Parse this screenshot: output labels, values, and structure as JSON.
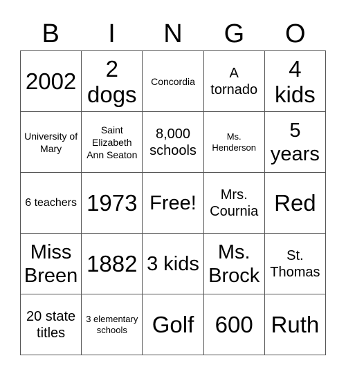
{
  "header": {
    "letters": [
      "B",
      "I",
      "N",
      "G",
      "O"
    ]
  },
  "cells": [
    {
      "text": "2002",
      "size": "s-xl"
    },
    {
      "text": "2 dogs",
      "size": "s-xl"
    },
    {
      "text": "Concordia",
      "size": "s-s"
    },
    {
      "text": "A tornado",
      "size": "s-m"
    },
    {
      "text": "4 kids",
      "size": "s-xl"
    },
    {
      "text": "University of Mary",
      "size": "s-s"
    },
    {
      "text": "Saint Elizabeth Ann Seaton",
      "size": "s-s"
    },
    {
      "text": "8,000 schools",
      "size": "s-m"
    },
    {
      "text": "Ms. Henderson",
      "size": "s-xs"
    },
    {
      "text": "5 years",
      "size": "s-l"
    },
    {
      "text": "6 teachers",
      "size": "s-sm"
    },
    {
      "text": "1973",
      "size": "s-xl"
    },
    {
      "text": "Free!",
      "size": "s-l"
    },
    {
      "text": "Mrs. Cournia",
      "size": "s-m"
    },
    {
      "text": "Red",
      "size": "s-xl"
    },
    {
      "text": "Miss Breen",
      "size": "s-l"
    },
    {
      "text": "1882",
      "size": "s-xl"
    },
    {
      "text": "3 kids",
      "size": "s-l"
    },
    {
      "text": "Ms. Brock",
      "size": "s-l"
    },
    {
      "text": "St. Thomas",
      "size": "s-m"
    },
    {
      "text": "20 state titles",
      "size": "s-m"
    },
    {
      "text": "3 elementary schools",
      "size": "s-xs"
    },
    {
      "text": "Golf",
      "size": "s-xl"
    },
    {
      "text": "600",
      "size": "s-xl"
    },
    {
      "text": "Ruth",
      "size": "s-xl"
    }
  ]
}
